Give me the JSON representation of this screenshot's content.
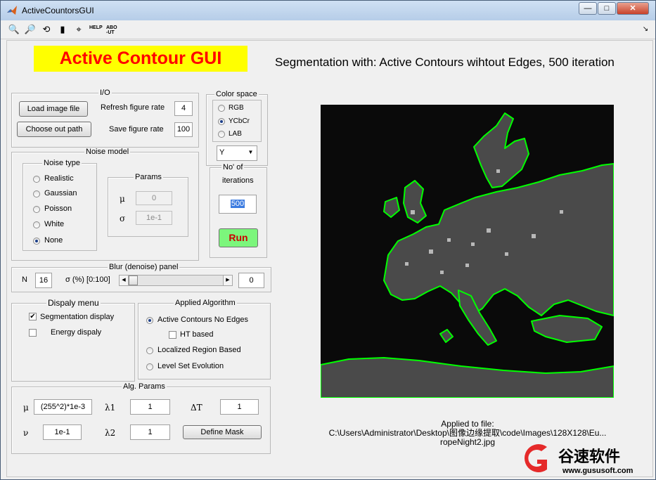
{
  "window": {
    "title": "ActiveCountorsGUI",
    "minimize": "—",
    "maximize": "□",
    "close": "✕"
  },
  "toolbar": {
    "help": "HELP",
    "about": "ABO-UT"
  },
  "header": {
    "app_title": "Active Contour GUI",
    "segmentation_caption": "Segmentation with: Active Contours wihtout Edges, 500 iteration"
  },
  "io": {
    "title": "I/O",
    "load_button": "Load image file",
    "choose_out_button": "Choose out path",
    "refresh_label": "Refresh figure rate",
    "refresh_value": "4",
    "save_label": "Save figure rate",
    "save_value": "100"
  },
  "color_space": {
    "title": "Color space",
    "options": [
      "RGB",
      "YCbCr",
      "LAB"
    ],
    "selected": "YCbCr",
    "channel": "Y"
  },
  "iterations": {
    "label_line1": "No'  of",
    "label_line2": "iterations",
    "value": "500",
    "run_button": "Run"
  },
  "noise_model": {
    "title": "Noise model",
    "noise_type_title": "Noise type",
    "options": [
      "Realistic",
      "Gaussian",
      "Poisson",
      "White",
      "None"
    ],
    "selected": "None",
    "params_title": "Params",
    "mu_symbol": "μ",
    "mu_value": "0",
    "sigma_symbol": "σ",
    "sigma_value": "1e-1"
  },
  "blur": {
    "title": "Blur (denoise) panel",
    "n_label": "N",
    "n_value": "16",
    "sigma_label": "σ (%) [0:100]",
    "slider_level": 0,
    "sigma_value": "0"
  },
  "display_menu": {
    "title": "Dispaly menu",
    "segmentation_label": "Segmentation display",
    "segmentation_checked": true,
    "energy_label": "Energy dispaly",
    "energy_checked": false
  },
  "algorithm": {
    "title": "Applied Algorithm",
    "acwe_label": "Active Contours No Edges",
    "ht_label": "HT based",
    "ht_checked": false,
    "lrb_label": "Localized Region Based",
    "lse_label": "Level Set Evolution",
    "selected": "Active Contours No Edges"
  },
  "alg_params": {
    "title": "Alg. Params",
    "mu_symbol": "μ",
    "mu_value": "(255^2)*1e-3",
    "lambda1_symbol": "λ1",
    "lambda1_value": "1",
    "dt_symbol": "ΔT",
    "dt_value": "1",
    "nu_symbol": "ν",
    "nu_value": "1e-1",
    "lambda2_symbol": "λ2",
    "lambda2_value": "1",
    "define_mask_button": "Define Mask"
  },
  "file_info": {
    "line1": "Applied to file:",
    "line2": "C:\\Users\\Administrator\\Desktop\\图像边缘提取\\code\\Images\\128X128\\Eu...",
    "line3": "ropeNight2.jpg"
  },
  "watermark": {
    "text": "谷速软件",
    "url": "www.gususoft.com"
  },
  "colors": {
    "title_bg": "#ffff00",
    "title_fg": "#ff0000",
    "run_bg": "#7cf67c",
    "run_fg": "#cc0000",
    "contour": "#00ff00",
    "image_bg": "#0a0a0a"
  }
}
